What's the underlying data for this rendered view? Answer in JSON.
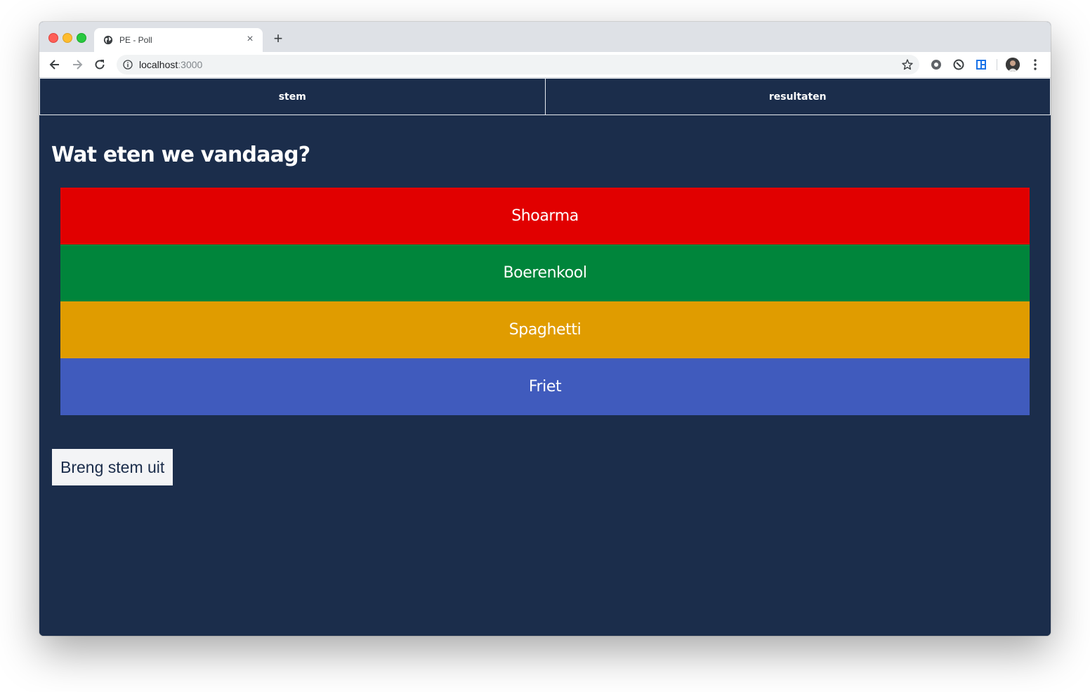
{
  "browser": {
    "tab_title": "PE - Poll",
    "tab_close": "×",
    "new_tab": "+",
    "url_host": "localhost",
    "url_port": ":3000"
  },
  "nav": {
    "items": [
      {
        "label": "stem"
      },
      {
        "label": "resultaten"
      }
    ]
  },
  "poll": {
    "question": "Wat eten we vandaag?",
    "options": [
      {
        "label": "Shoarma",
        "color": "#e10000"
      },
      {
        "label": "Boerenkool",
        "color": "#00853b"
      },
      {
        "label": "Spaghetti",
        "color": "#e09c00"
      },
      {
        "label": "Friet",
        "color": "#405bbd"
      }
    ],
    "submit_label": "Breng stem uit"
  },
  "colors": {
    "page_background": "#1b2d4b",
    "button_background": "#f3f4f6"
  }
}
